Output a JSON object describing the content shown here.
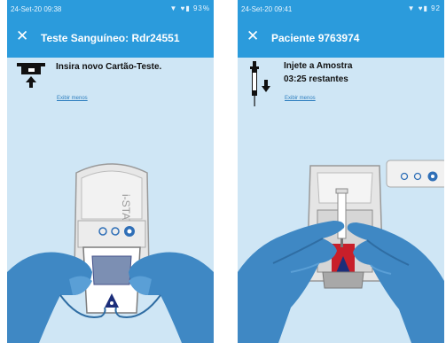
{
  "screens": [
    {
      "status_time": "24-Set-20 09:38",
      "status_icons": "▼ ♥▮ 93%",
      "title": "Teste Sanguíneo: Rdr24551",
      "instruction_line1": "Insira novo Cartão-Teste.",
      "link_text": "Exibir menos"
    },
    {
      "status_time": "24-Set-20 09:41",
      "status_icons": "▼ ♥▮ 92",
      "title": "Paciente 9763974",
      "instruction_line1": "Injete a Amostra",
      "instruction_line2": "03:25 restantes",
      "link_text": "Exibir menos"
    }
  ],
  "icons": {
    "close": "close-icon",
    "insert": "insert-card-icon",
    "syringe": "syringe-icon"
  },
  "colors": {
    "appbar": "#2b9bdc",
    "background": "#cfe6f5",
    "glove": "#3f88c4"
  }
}
